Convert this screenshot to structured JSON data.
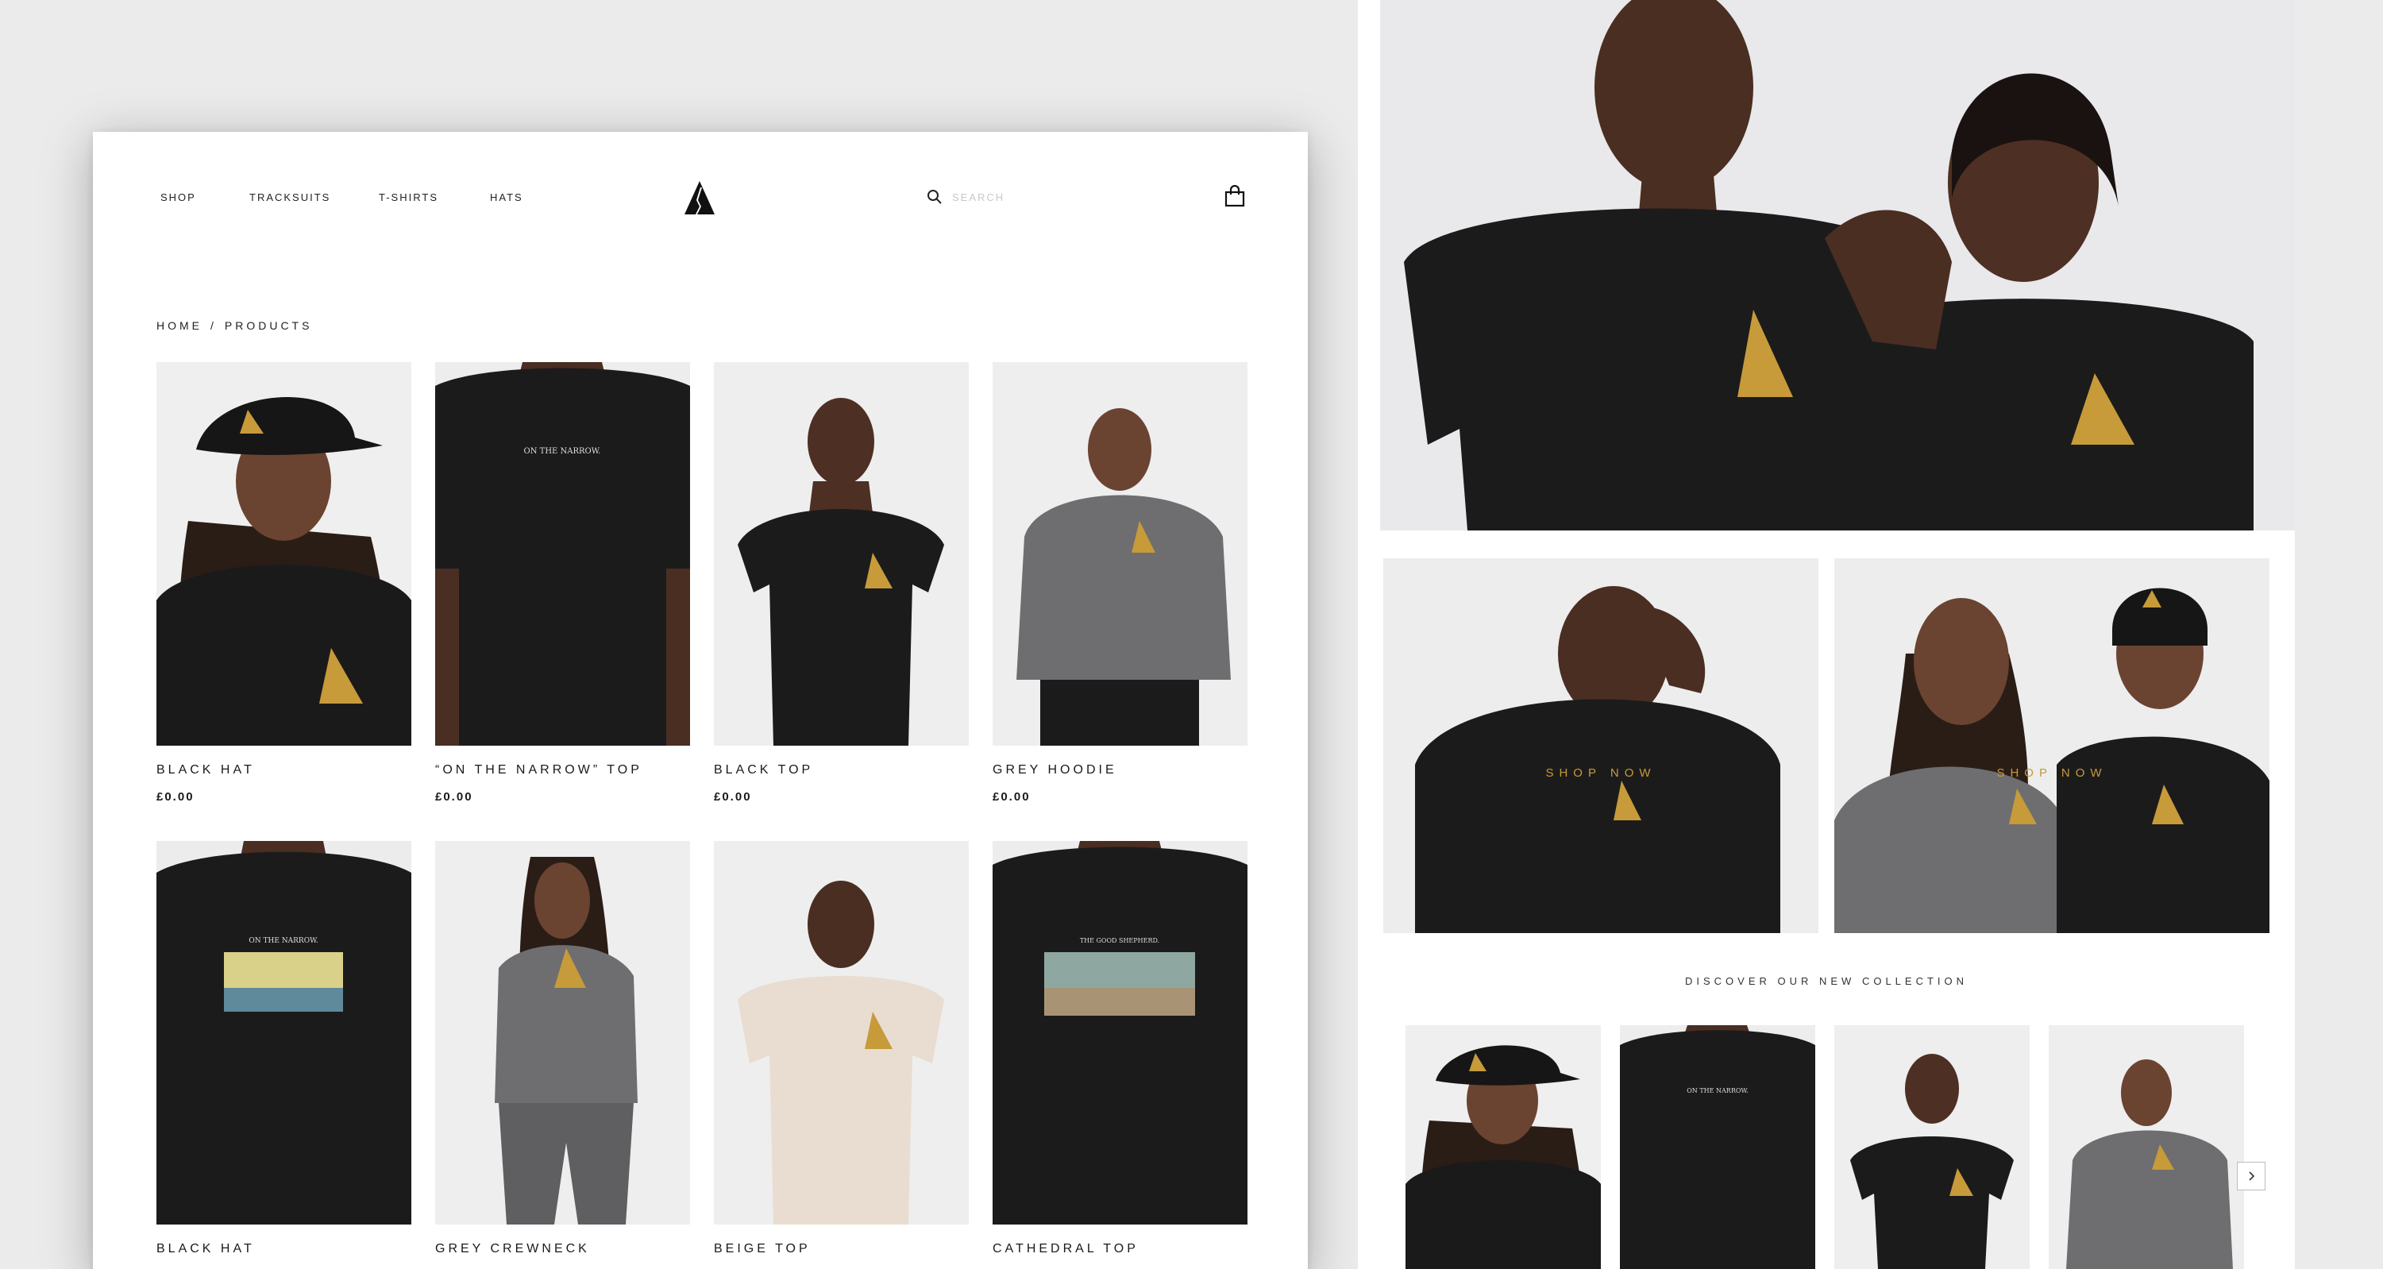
{
  "shop": {
    "nav": {
      "shop": "Shop",
      "tracksuits": "Tracksuits",
      "tshirts": "T-Shirts",
      "hats": "Hats"
    },
    "search": {
      "placeholder": "SEARCH"
    },
    "breadcrumb": {
      "home": "Home",
      "separator": "/",
      "current": "Products"
    },
    "products": [
      {
        "name": "Black Hat",
        "price": "£0.00",
        "print": ""
      },
      {
        "name": "“On The Narrow” Top",
        "price": "£0.00",
        "print": "ON THE NARROW."
      },
      {
        "name": "Black Top",
        "price": "£0.00",
        "print": ""
      },
      {
        "name": "Grey Hoodie",
        "price": "£0.00",
        "print": ""
      },
      {
        "name": "Black Hat",
        "price": "",
        "print": "ON THE NARROW."
      },
      {
        "name": "Grey Crewneck",
        "price": "",
        "print": ""
      },
      {
        "name": "Beige Top",
        "price": "",
        "print": ""
      },
      {
        "name": "Cathedral Top",
        "price": "",
        "print": "THE GOOD SHEPHERD."
      }
    ]
  },
  "home": {
    "banner_left_cta": "Shop Now",
    "banner_right_cta": "Shop Now",
    "discover": "Discover Our New Collection",
    "mini_prints": [
      "",
      "ON THE NARROW.",
      "",
      ""
    ]
  },
  "colors": {
    "gold": "#c79a3a",
    "black_garment": "#1c1b1c",
    "grey_garment": "#6e6e70",
    "beige_garment": "#e8ddd0",
    "skin": "#5a3a2a",
    "photo_bg": "#eeeeee"
  },
  "icons": [
    "logo-icon",
    "search-icon",
    "shopping-bag-icon",
    "chevron-right-icon"
  ]
}
